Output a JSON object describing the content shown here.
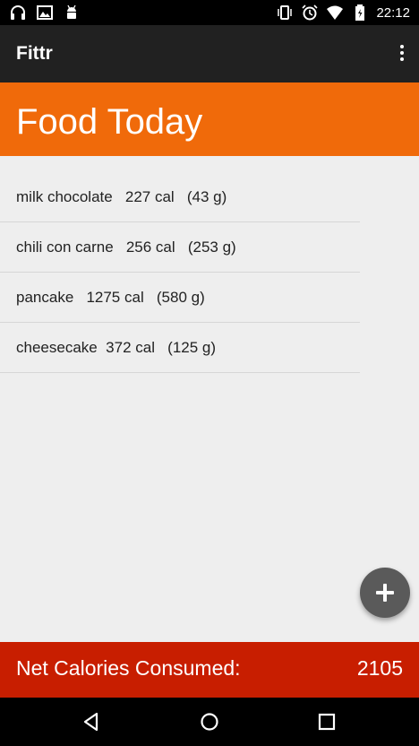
{
  "status_bar": {
    "time": "22:12",
    "left_icons": [
      "headphones-icon",
      "image-icon",
      "android-icon"
    ],
    "right_icons": [
      "vibrate-icon",
      "alarm-icon",
      "wifi-icon",
      "battery-icon"
    ]
  },
  "app_bar": {
    "title": "Fittr",
    "overflow_icon": "more-vert-icon"
  },
  "header": {
    "title": "Food Today",
    "color": "#f06a0a"
  },
  "food_items": [
    {
      "text": "milk chocolate   227 cal   (43 g)"
    },
    {
      "text": "chili con carne   256 cal   (253 g)"
    },
    {
      "text": "pancake   1275 cal   (580 g)"
    },
    {
      "text": "cheesecake  372 cal   (125 g)"
    }
  ],
  "fab": {
    "icon": "plus-icon"
  },
  "summary": {
    "label": "Net Calories Consumed:",
    "value": "2105",
    "color": "#c81e00"
  },
  "nav_bar": {
    "icons": [
      "back-icon",
      "home-icon",
      "recents-icon"
    ]
  }
}
